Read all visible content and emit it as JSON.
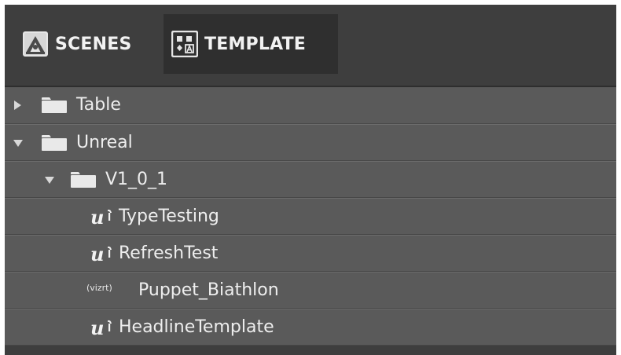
{
  "tabs": [
    {
      "label": "SCENES",
      "icon": "scenes-icon",
      "active": false
    },
    {
      "label": "TEMPLATE",
      "icon": "template-icon",
      "active": true
    }
  ],
  "tree": {
    "items": [
      {
        "label": "Table",
        "type": "folder",
        "expanded": false
      },
      {
        "label": "Unreal",
        "type": "folder",
        "expanded": true
      },
      {
        "label": "V1_0_1",
        "type": "folder",
        "expanded": true
      },
      {
        "label": "TypeTesting",
        "type": "unreal-template"
      },
      {
        "label": "RefreshTest",
        "type": "unreal-template"
      },
      {
        "label": "Puppet_Biathlon",
        "type": "vizrt-template",
        "badge": "(vizrt)"
      },
      {
        "label": "HeadlineTemplate",
        "type": "unreal-template"
      }
    ]
  },
  "colors": {
    "panel_bg": "#3e3e3e",
    "active_tab_bg": "#2f2f2f",
    "row_bg": "#5a5a5a",
    "text": "#eeeeee"
  }
}
